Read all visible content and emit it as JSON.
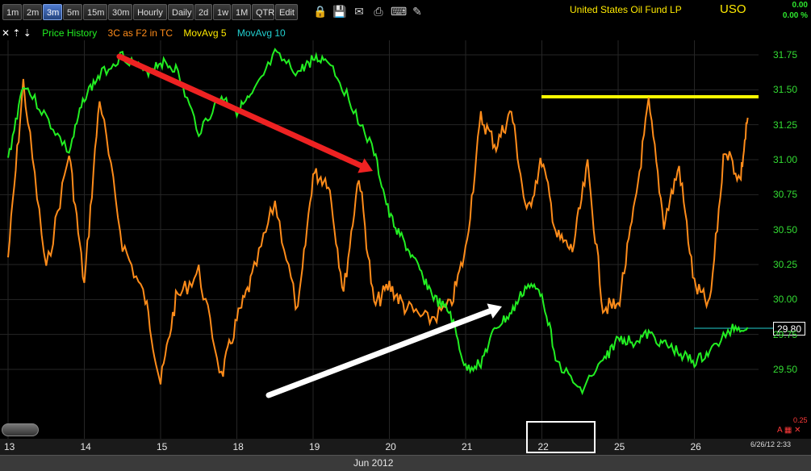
{
  "toolbar": {
    "intervals": [
      "1m",
      "2m",
      "3m",
      "5m",
      "15m",
      "30m",
      "Hourly",
      "Daily",
      "2d",
      "1w",
      "1M",
      "QTR",
      "Edit"
    ],
    "active_interval": "3m",
    "icons": [
      "lock-icon",
      "save-icon",
      "email-icon",
      "print-icon",
      "keyboard-icon",
      "pencil-icon"
    ]
  },
  "symbol": {
    "name": "United States Oil Fund LP",
    "ticker": "USO"
  },
  "change": {
    "value": "0.00",
    "percent": "0.00 %"
  },
  "legend": {
    "controls": "✕ ⇡ ⇣",
    "price": "Price History",
    "indicator": "3C as F2 in TC",
    "ma5": "MovAvg 5",
    "ma10": "MovAvg 10"
  },
  "last_price": "29.80",
  "date_stamp": "6/26/12 2:33",
  "indicator_scale_label": "0.25",
  "axis_toggle_icons": "A ▦ ✕",
  "month": "Jun 2012",
  "colors": {
    "price": "#22ee22",
    "indicator": "#ff8c1a",
    "ma5": "#ffea00",
    "ma10": "#22d0d0",
    "resistance": "#ffff00",
    "red_arrow": "#ee2222",
    "white_arrow": "#ffffff"
  },
  "chart_data": {
    "type": "line",
    "x_labels": [
      "13",
      "14",
      "15",
      "18",
      "19",
      "20",
      "21",
      "22",
      "25",
      "26"
    ],
    "ylim": [
      29.25,
      31.85
    ],
    "y_ticks": [
      "31.75",
      "31.50",
      "31.25",
      "31.00",
      "30.75",
      "30.50",
      "30.25",
      "30.00",
      "29.75",
      "29.50"
    ],
    "series": [
      {
        "name": "Price History",
        "x": [
          0,
          0.2,
          0.5,
          0.8,
          1.0,
          1.2,
          1.5,
          1.8,
          2.0,
          2.2,
          2.5,
          2.8,
          3.0,
          3.2,
          3.5,
          3.8,
          4.0,
          4.2,
          4.5,
          4.8,
          5.0,
          5.2,
          5.4,
          5.6,
          5.8,
          6.0,
          6.2,
          6.4,
          6.6,
          6.8,
          7.0,
          7.2,
          7.5,
          7.8,
          8.0,
          8.2,
          8.4,
          8.6,
          8.8,
          9.0,
          9.2,
          9.5,
          9.7
        ],
        "values": [
          31.0,
          31.55,
          31.3,
          31.05,
          31.45,
          31.6,
          31.75,
          31.62,
          31.7,
          31.65,
          31.2,
          31.45,
          31.35,
          31.45,
          31.75,
          31.62,
          31.72,
          31.72,
          31.4,
          31.05,
          30.6,
          30.4,
          30.2,
          30.0,
          29.9,
          29.5,
          29.55,
          29.8,
          29.9,
          30.1,
          30.05,
          29.55,
          29.35,
          29.55,
          29.72,
          29.7,
          29.75,
          29.68,
          29.62,
          29.55,
          29.62,
          29.8,
          29.8
        ]
      },
      {
        "name": "3C as F2 in TC",
        "x": [
          0,
          0.2,
          0.5,
          0.8,
          1.0,
          1.2,
          1.5,
          1.8,
          2.0,
          2.2,
          2.5,
          2.8,
          3.0,
          3.2,
          3.5,
          3.8,
          4.0,
          4.2,
          4.4,
          4.6,
          4.8,
          5.0,
          5.2,
          5.5,
          5.8,
          6.0,
          6.2,
          6.4,
          6.6,
          6.8,
          7.0,
          7.2,
          7.4,
          7.6,
          7.8,
          8.0,
          8.2,
          8.4,
          8.6,
          8.8,
          9.0,
          9.2,
          9.4,
          9.6,
          9.7
        ],
        "values": [
          30.3,
          31.55,
          30.2,
          31.05,
          30.1,
          31.45,
          30.4,
          30.0,
          29.4,
          30.0,
          30.2,
          29.45,
          29.85,
          30.15,
          30.7,
          29.9,
          30.9,
          30.85,
          30.05,
          30.9,
          29.95,
          30.1,
          29.95,
          29.85,
          29.95,
          30.35,
          31.3,
          31.1,
          31.35,
          30.6,
          31.0,
          30.45,
          30.35,
          30.95,
          29.95,
          29.95,
          30.6,
          31.4,
          30.55,
          30.95,
          30.1,
          29.95,
          31.1,
          30.85,
          31.3
        ]
      }
    ],
    "resistance_level": 31.45,
    "annotations": [
      {
        "type": "arrow",
        "color": "red",
        "from": "31.75 near 14",
        "to": "30.9 near 20"
      },
      {
        "type": "arrow",
        "color": "white",
        "from": "29.4 near 18",
        "to": "29.95 near 21-22"
      }
    ]
  }
}
